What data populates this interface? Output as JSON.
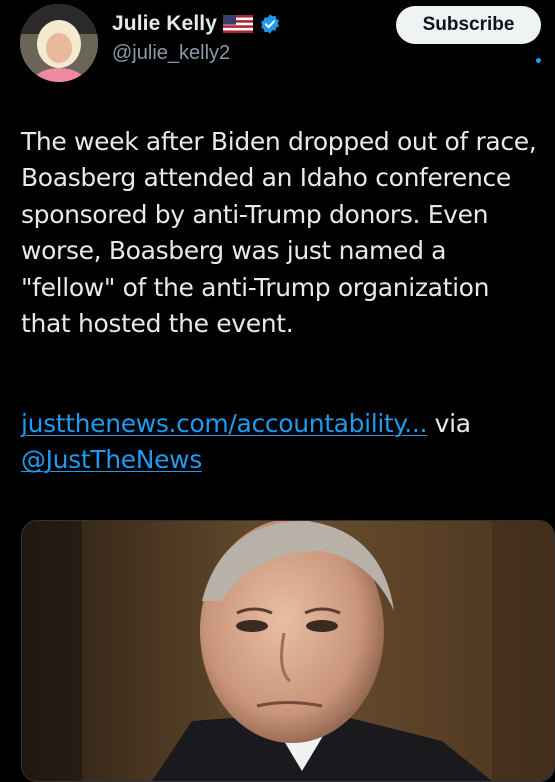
{
  "author": {
    "display_name": "Julie Kelly",
    "handle": "@julie_kelly2",
    "flag_icon": "us-flag-icon",
    "verified_icon": "verified-badge-icon",
    "verified_color": "#1d9bf0"
  },
  "actions": {
    "subscribe_label": "Subscribe"
  },
  "tweet": {
    "body": "The week after Biden dropped out of race, Boasberg attended an Idaho conference sponsored by anti-Trump donors. Even worse, Boasberg was just named a \"fellow\" of the anti-Trump organization that hosted the event.",
    "link_text": "justthenews.com/accountability...",
    "via_text": " via ",
    "mention": "@JustTheNews"
  },
  "colors": {
    "background": "#000000",
    "text": "#e7e9ea",
    "secondary_text": "#8b98a5",
    "link": "#1d9bf0"
  }
}
